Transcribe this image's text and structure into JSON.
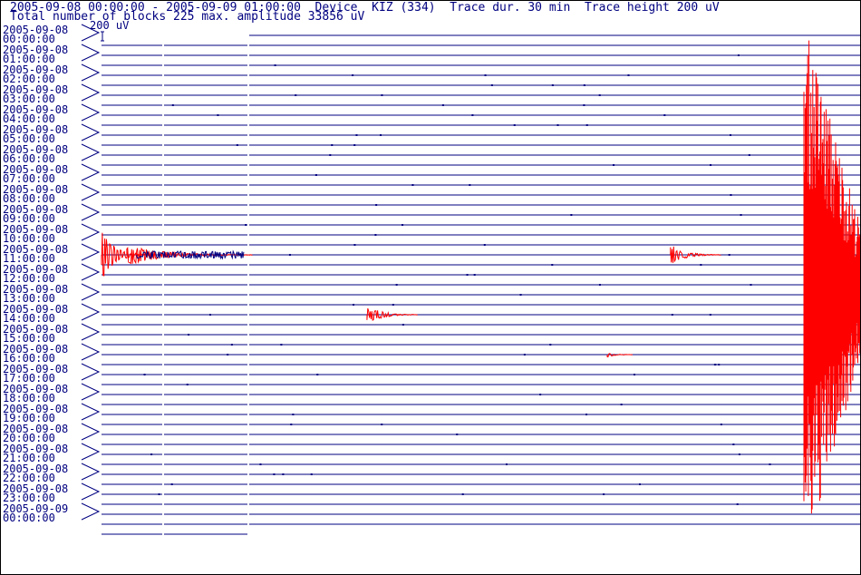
{
  "header": {
    "line1": "2005-09-08 00:00:00 - 2005-09-09 01:00:00  Device  KIZ (334)  Trace dur. 30 min  Trace height 200 uV",
    "line2": "Total number of blocks 225 max. amplitude 33856 uV"
  },
  "scale_label": "200 uV",
  "colors": {
    "trace": "#000080",
    "event": "#ff0000",
    "text": "#000080",
    "background": "#ffffff"
  },
  "chart_data": {
    "type": "seismogram",
    "station": "KIZ (334)",
    "start": "2005-09-08 00:00:00",
    "end": "2005-09-09 01:00:00",
    "trace_duration_min": 30,
    "trace_height_uV": 200,
    "total_blocks": 225,
    "max_amplitude_uV": 33856,
    "row_labels": [
      {
        "date": "2005-09-08",
        "time": "00:00:00"
      },
      {
        "date": "2005-09-08",
        "time": "01:00:00"
      },
      {
        "date": "2005-09-08",
        "time": "02:00:00"
      },
      {
        "date": "2005-09-08",
        "time": "03:00:00"
      },
      {
        "date": "2005-09-08",
        "time": "04:00:00"
      },
      {
        "date": "2005-09-08",
        "time": "05:00:00"
      },
      {
        "date": "2005-09-08",
        "time": "06:00:00"
      },
      {
        "date": "2005-09-08",
        "time": "07:00:00"
      },
      {
        "date": "2005-09-08",
        "time": "08:00:00"
      },
      {
        "date": "2005-09-08",
        "time": "09:00:00"
      },
      {
        "date": "2005-09-08",
        "time": "10:00:00"
      },
      {
        "date": "2005-09-08",
        "time": "11:00:00"
      },
      {
        "date": "2005-09-08",
        "time": "12:00:00"
      },
      {
        "date": "2005-09-08",
        "time": "13:00:00"
      },
      {
        "date": "2005-09-08",
        "time": "14:00:00"
      },
      {
        "date": "2005-09-08",
        "time": "15:00:00"
      },
      {
        "date": "2005-09-08",
        "time": "16:00:00"
      },
      {
        "date": "2005-09-08",
        "time": "17:00:00"
      },
      {
        "date": "2005-09-08",
        "time": "18:00:00"
      },
      {
        "date": "2005-09-08",
        "time": "19:00:00"
      },
      {
        "date": "2005-09-08",
        "time": "20:00:00"
      },
      {
        "date": "2005-09-08",
        "time": "21:00:00"
      },
      {
        "date": "2005-09-08",
        "time": "22:00:00"
      },
      {
        "date": "2005-09-08",
        "time": "23:00:00"
      },
      {
        "date": "2005-09-09",
        "time": "00:00:00"
      }
    ],
    "events": [
      {
        "start": "2005-09-08 11:00:00",
        "duration_min": 2,
        "level": "strong"
      },
      {
        "start": "2005-09-08 11:01:00",
        "duration_min": 5,
        "level": "moderate"
      },
      {
        "start": "2005-09-08 11:22:30",
        "duration_min": 2,
        "level": "moderate"
      },
      {
        "start": "2005-09-08 14:10:30",
        "duration_min": 2,
        "level": "moderate"
      },
      {
        "start": "2005-09-08 16:20:00",
        "duration_min": 1,
        "level": "weak"
      },
      {
        "start": "2005-09-08 11:30:00",
        "duration_min": 30,
        "level": "very strong"
      }
    ]
  }
}
